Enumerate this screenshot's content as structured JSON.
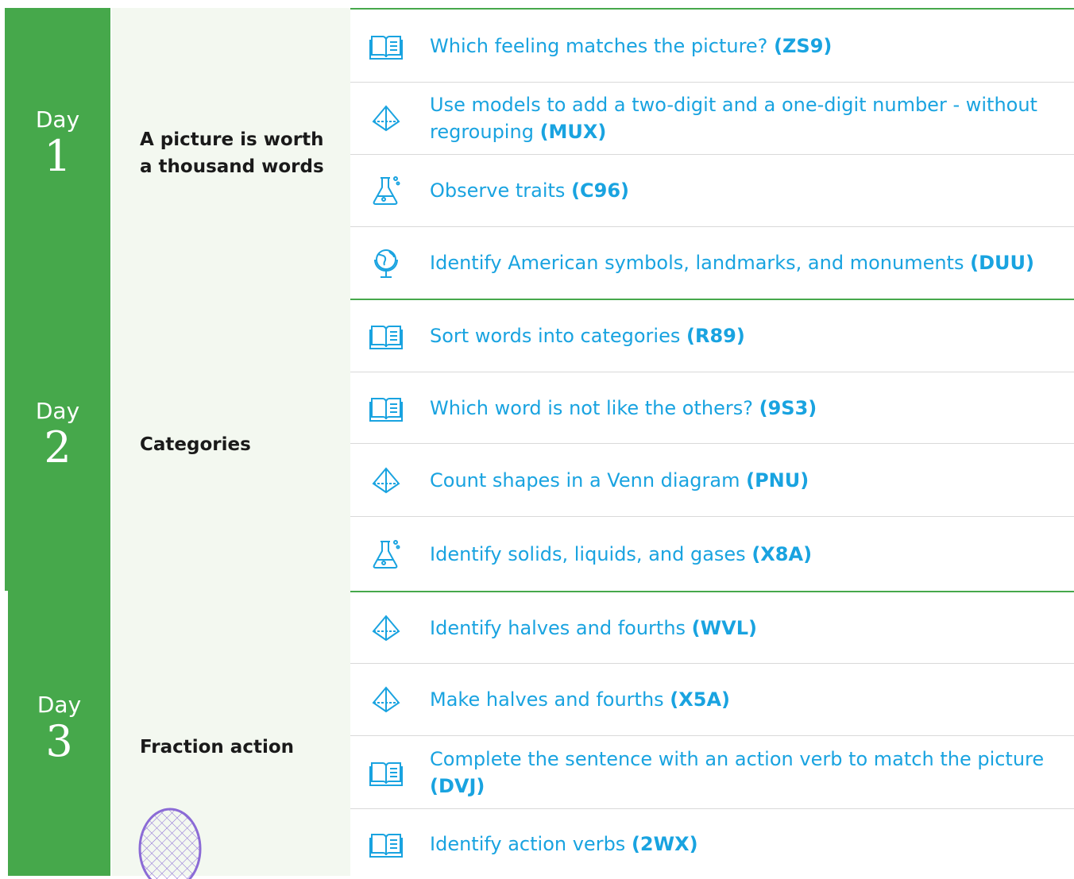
{
  "days": [
    {
      "label": "Day",
      "number": "1",
      "topic": "A picture is worth a thousand words",
      "skills": [
        {
          "icon": "book-icon",
          "text": "Which feeling matches the picture?",
          "code": "(ZS9)"
        },
        {
          "icon": "pyramid-icon",
          "text": "Use models to add a two-digit and a one-digit number - without regrouping",
          "code": "(MUX)"
        },
        {
          "icon": "flask-icon",
          "text": "Observe traits",
          "code": "(C96)"
        },
        {
          "icon": "globe-icon",
          "text": "Identify American symbols, landmarks, and monuments",
          "code": "(DUU)"
        }
      ]
    },
    {
      "label": "Day",
      "number": "2",
      "topic": "Categories",
      "skills": [
        {
          "icon": "book-icon",
          "text": "Sort words into categories",
          "code": "(R89)"
        },
        {
          "icon": "book-icon",
          "text": "Which word is not like the others?",
          "code": "(9S3)"
        },
        {
          "icon": "pyramid-icon",
          "text": "Count shapes in a Venn diagram",
          "code": "(PNU)"
        },
        {
          "icon": "flask-icon",
          "text": "Identify solids, liquids, and gases",
          "code": "(X8A)"
        }
      ]
    },
    {
      "label": "Day",
      "number": "3",
      "topic": "Fraction action",
      "skills": [
        {
          "icon": "pyramid-icon",
          "text": "Identify halves and fourths",
          "code": "(WVL)"
        },
        {
          "icon": "pyramid-icon",
          "text": "Make halves and fourths",
          "code": "(X5A)"
        },
        {
          "icon": "book-icon",
          "text": "Complete the sentence with an action verb to match the picture",
          "code": "(DVJ)"
        },
        {
          "icon": "book-icon",
          "text": "Identify action verbs",
          "code": "(2WX)"
        }
      ]
    }
  ],
  "colors": {
    "day_green": "#46a84b",
    "topic_bg": "#f3f8f0",
    "link_blue": "#19a3e0",
    "racket_purple": "#8b6bd6"
  }
}
